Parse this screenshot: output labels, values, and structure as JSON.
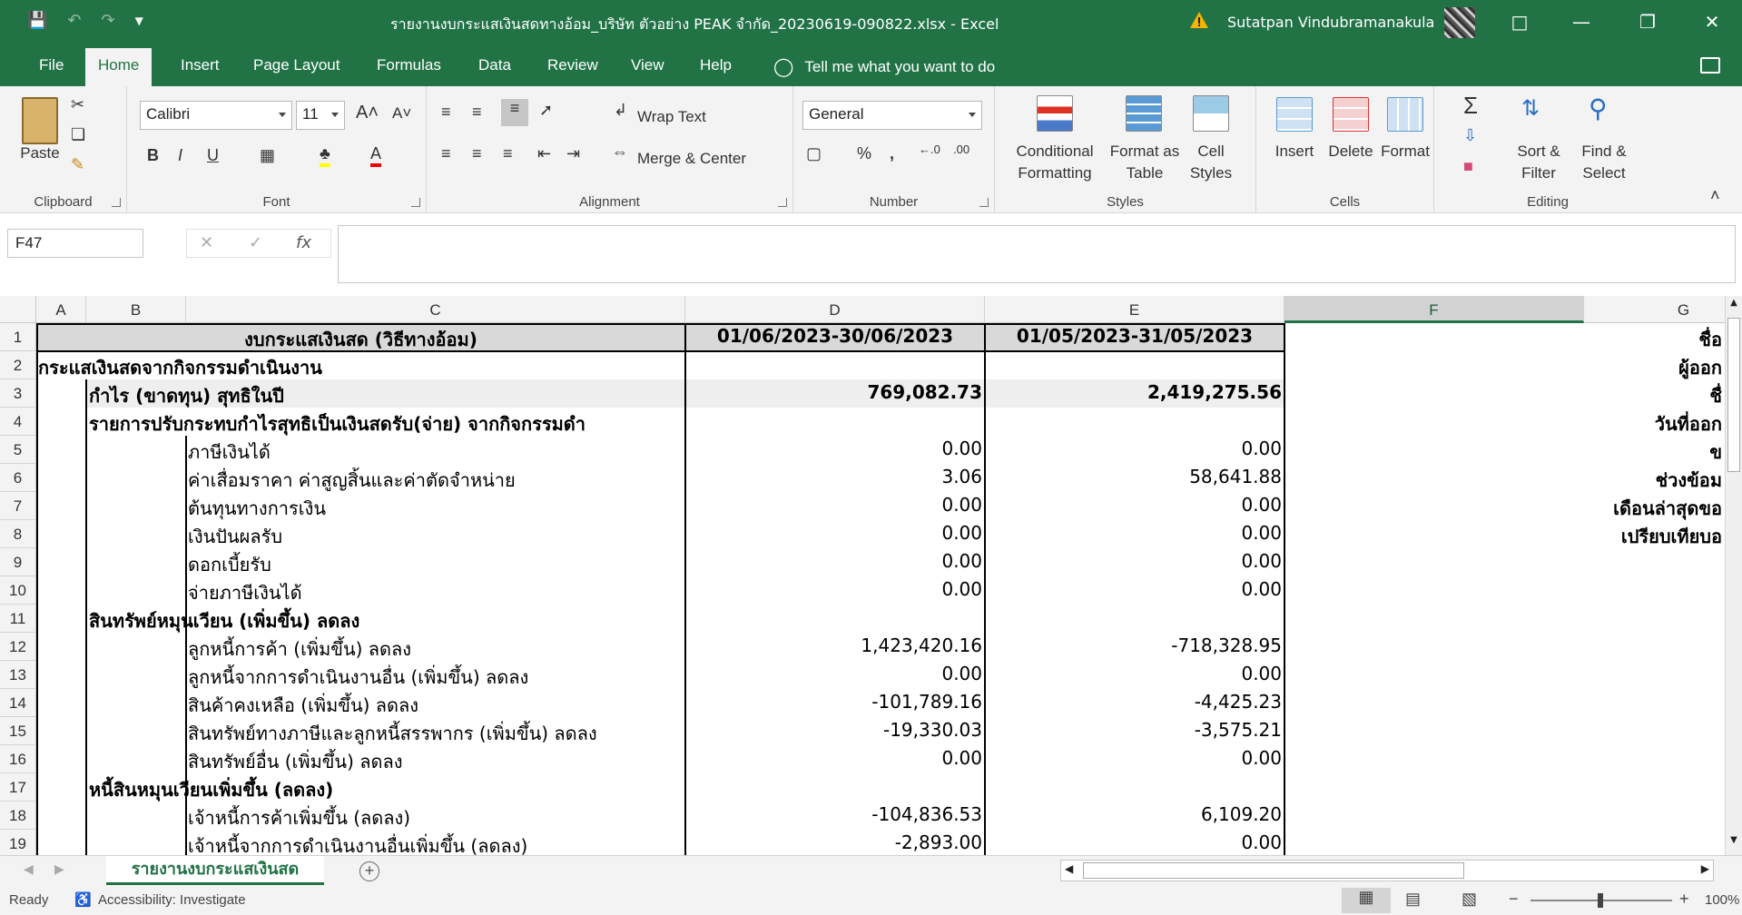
{
  "titlebar": {
    "title": "รายงานงบกระแสเงินสดทางอ้อม_บริษัท ตัวอย่าง PEAK จำกัด_20230619-090822.xlsx  -  Excel",
    "user": "Sutatpan Vindubramanakula",
    "accent": "#217346"
  },
  "menu": {
    "tabs": [
      "File",
      "Home",
      "Insert",
      "Page Layout",
      "Formulas",
      "Data",
      "Review",
      "View",
      "Help"
    ],
    "active": "Home",
    "tell_me": "Tell me what you want to do"
  },
  "ribbon": {
    "clipboard": {
      "label": "Clipboard",
      "paste": "Paste"
    },
    "font": {
      "label": "Font",
      "name": "Calibri",
      "size": "11"
    },
    "alignment": {
      "label": "Alignment",
      "wrap": "Wrap Text",
      "merge": "Merge & Center"
    },
    "number": {
      "label": "Number",
      "format": "General"
    },
    "styles": {
      "label": "Styles",
      "conditional": "Conditional",
      "conditional2": "Formatting",
      "format_as": "Format as",
      "format_as2": "Table",
      "cell": "Cell",
      "cell2": "Styles"
    },
    "cells": {
      "label": "Cells",
      "insert": "Insert",
      "delete": "Delete",
      "format": "Format"
    },
    "editing": {
      "label": "Editing",
      "sort": "Sort &",
      "sort2": "Filter",
      "find": "Find &",
      "find2": "Select"
    }
  },
  "formula_bar": {
    "name_box": "F47",
    "fx": "fx",
    "content": ""
  },
  "columns": [
    "A",
    "B",
    "C",
    "D",
    "E",
    "F",
    "G"
  ],
  "selected_column": "F",
  "rows": [
    {
      "n": "1",
      "c": "งบกระแสเงินสด (วิธีทางอ้อม)",
      "d": "01/06/2023-30/06/2023",
      "e": "01/05/2023-31/05/2023",
      "g": "ชื่อ"
    },
    {
      "n": "2",
      "b": "กระแสเงินสดจากกิจกรรมดำเนินงาน",
      "g": "ผู้ออก"
    },
    {
      "n": "3",
      "b": "กำไร (ขาดทุน) สุทธิในปี",
      "d": "769,082.73",
      "e": "2,419,275.56",
      "g": "ชื่"
    },
    {
      "n": "4",
      "b": "รายการปรับกระทบกำไรสุทธิเป็นเงินสดรับ(จ่าย) จากกิจกรรมดำ",
      "g": "วันที่ออก"
    },
    {
      "n": "5",
      "c": "ภาษีเงินได้",
      "d": "0.00",
      "e": "0.00",
      "g": "ข"
    },
    {
      "n": "6",
      "c": "ค่าเสื่อมราคา ค่าสูญสิ้นและค่าตัดจำหน่าย",
      "d": "3.06",
      "e": "58,641.88",
      "g": "ช่วงข้อม"
    },
    {
      "n": "7",
      "c": "ต้นทุนทางการเงิน",
      "d": "0.00",
      "e": "0.00",
      "g": "เดือนล่าสุดขอ"
    },
    {
      "n": "8",
      "c": "เงินปันผลรับ",
      "d": "0.00",
      "e": "0.00",
      "g": "เปรียบเทียบอ"
    },
    {
      "n": "9",
      "c": "ดอกเบี้ยรับ",
      "d": "0.00",
      "e": "0.00"
    },
    {
      "n": "10",
      "c": "จ่ายภาษีเงินได้",
      "d": "0.00",
      "e": "0.00"
    },
    {
      "n": "11",
      "b": "สินทรัพย์หมุนเวียน (เพิ่มขึ้น) ลดลง"
    },
    {
      "n": "12",
      "c": "ลูกหนี้การค้า (เพิ่มขึ้น) ลดลง",
      "d": "1,423,420.16",
      "e": "-718,328.95"
    },
    {
      "n": "13",
      "c": "ลูกหนี้จากการดำเนินงานอื่น (เพิ่มขึ้น) ลดลง",
      "d": "0.00",
      "e": "0.00"
    },
    {
      "n": "14",
      "c": "สินค้าคงเหลือ (เพิ่มขึ้น) ลดลง",
      "d": "-101,789.16",
      "e": "-4,425.23"
    },
    {
      "n": "15",
      "c": "สินทรัพย์ทางภาษีและลูกหนี้สรรพากร (เพิ่มขึ้น) ลดลง",
      "d": "-19,330.03",
      "e": "-3,575.21"
    },
    {
      "n": "16",
      "c": "สินทรัพย์อื่น (เพิ่มขึ้น) ลดลง",
      "d": "0.00",
      "e": "0.00"
    },
    {
      "n": "17",
      "b": "หนี้สินหมุนเวียนเพิ่มขึ้น (ลดลง)"
    },
    {
      "n": "18",
      "c": "เจ้าหนี้การค้าเพิ่มขึ้น (ลดลง)",
      "d": "-104,836.53",
      "e": "6,109.20"
    },
    {
      "n": "19",
      "c": "เจ้าหนี้จากการดำเนินงานอื่นเพิ่มขึ้น (ลดลง)",
      "d": "-2,893.00",
      "e": "0.00"
    }
  ],
  "sheet": {
    "tab": "รายงานงบกระแสเงินสด",
    "add": "+"
  },
  "status": {
    "ready": "Ready",
    "accessibility": "Accessibility: Investigate",
    "zoom": "100%"
  }
}
